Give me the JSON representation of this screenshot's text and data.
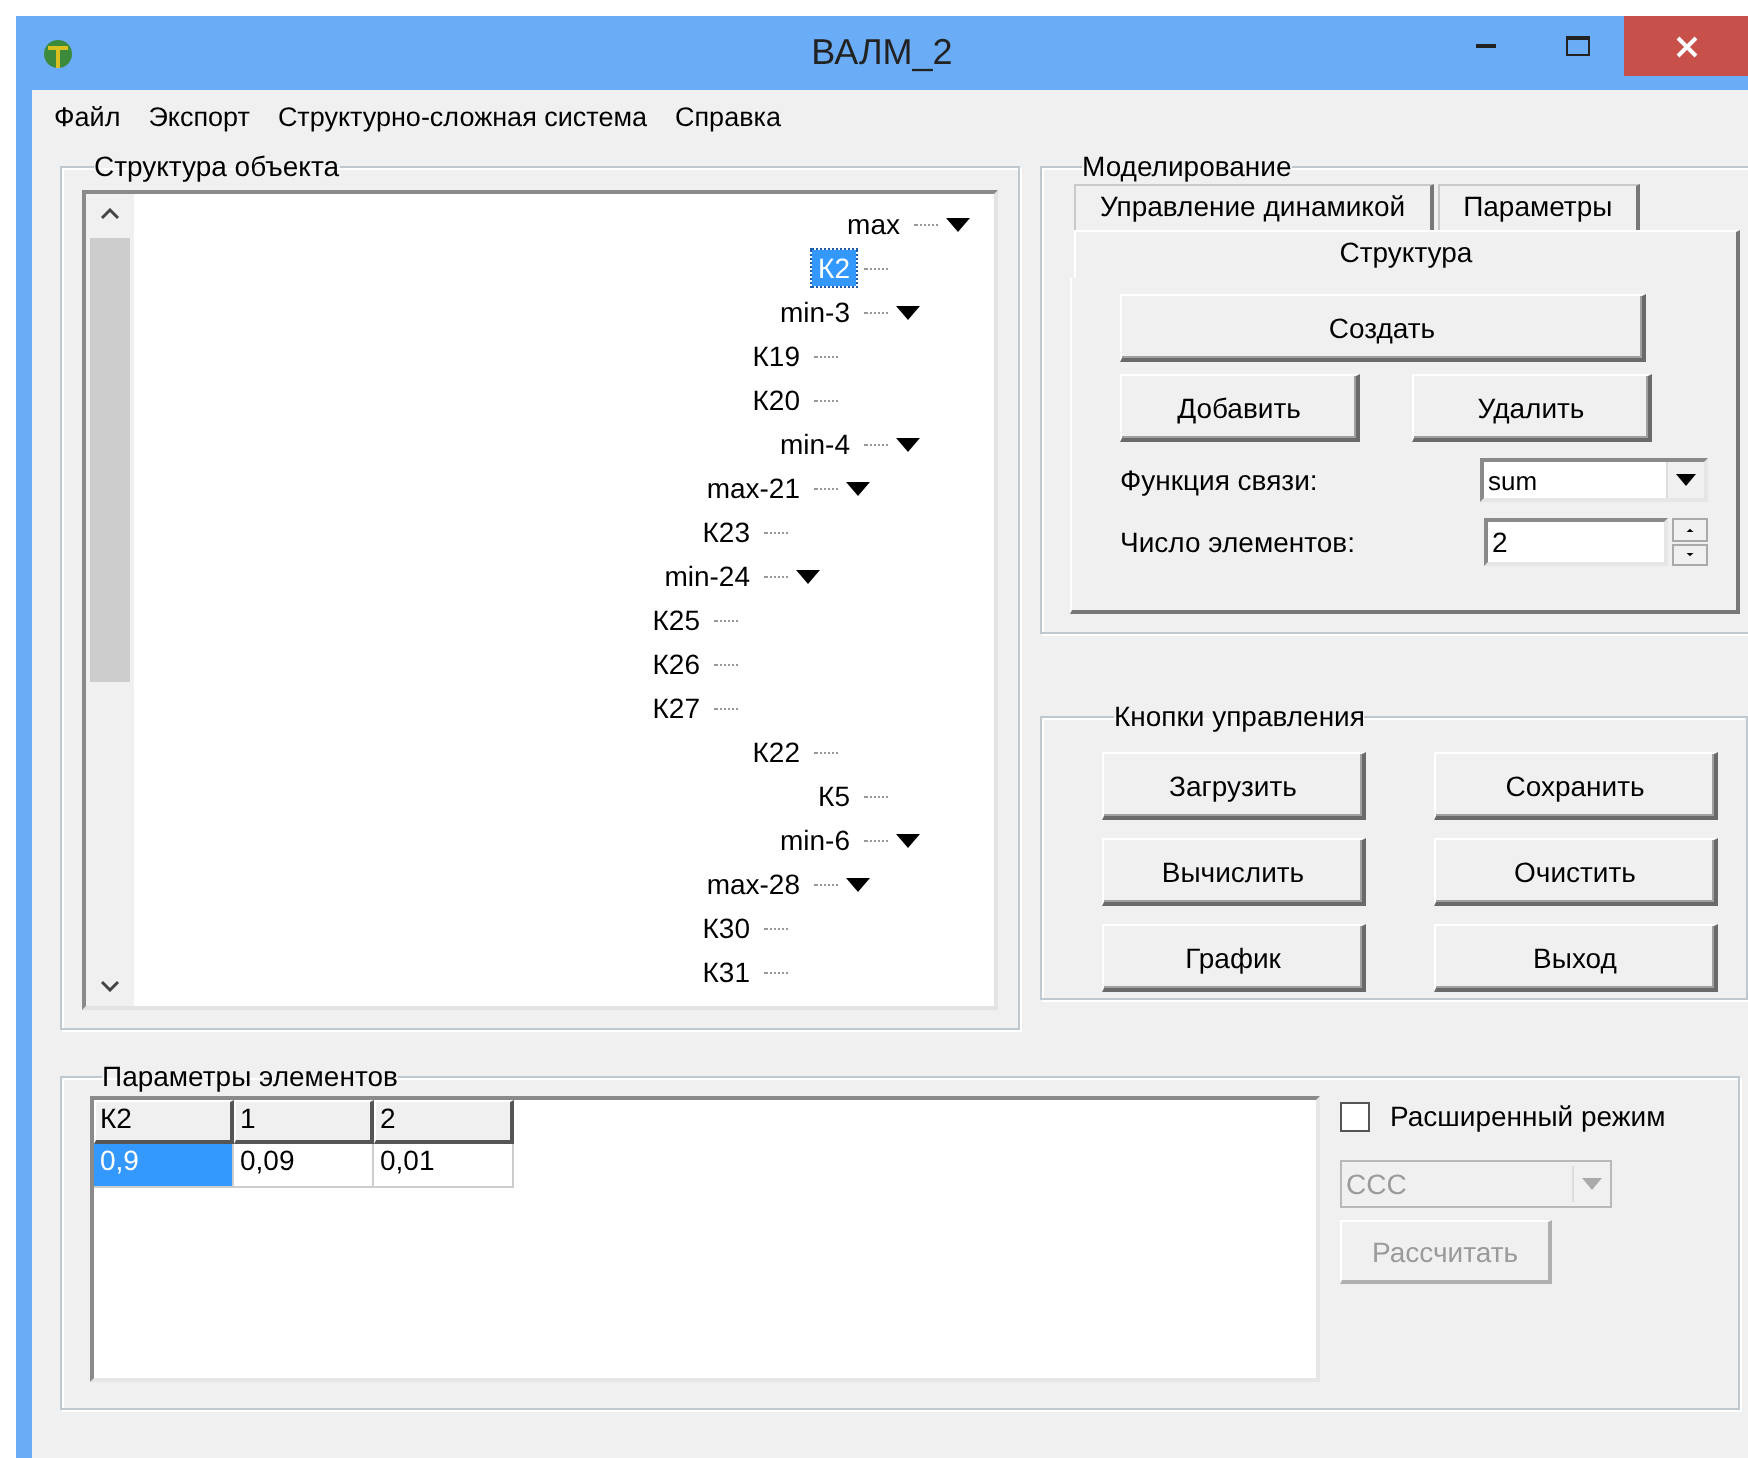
{
  "window": {
    "title": "ВАЛМ_2"
  },
  "menu": [
    "Файл",
    "Экспорт",
    "Структурно-сложная система",
    "Справка"
  ],
  "structure_panel": {
    "title": "Структура объекта",
    "tree": [
      {
        "label": "max",
        "selected": false,
        "expanded": true,
        "children": [
          {
            "label": "К2",
            "selected": true
          },
          {
            "label": "min-3",
            "selected": false,
            "expanded": true,
            "children": [
              {
                "label": "К19",
                "selected": false
              },
              {
                "label": "К20",
                "selected": false
              }
            ]
          },
          {
            "label": "min-4",
            "selected": false,
            "expanded": true,
            "children": [
              {
                "label": "max-21",
                "selected": false,
                "expanded": true,
                "children": [
                  {
                    "label": "К23",
                    "selected": false
                  },
                  {
                    "label": "min-24",
                    "selected": false,
                    "expanded": true,
                    "children": [
                      {
                        "label": "К25",
                        "selected": false
                      },
                      {
                        "label": "К26",
                        "selected": false
                      },
                      {
                        "label": "К27",
                        "selected": false
                      }
                    ]
                  }
                ]
              },
              {
                "label": "К22",
                "selected": false
              }
            ]
          },
          {
            "label": "К5",
            "selected": false
          },
          {
            "label": "min-6",
            "selected": false,
            "expanded": true,
            "children": [
              {
                "label": "max-28",
                "selected": false,
                "expanded": true,
                "children": [
                  {
                    "label": "К30",
                    "selected": false
                  },
                  {
                    "label": "К31",
                    "selected": false
                  }
                ]
              }
            ]
          }
        ]
      }
    ]
  },
  "modeling": {
    "title": "Моделирование",
    "tabs": [
      {
        "label": "Управление динамикой",
        "selected": false
      },
      {
        "label": "Параметры",
        "selected": false
      },
      {
        "label": "Структура",
        "selected": true
      }
    ],
    "create_button": "Создать",
    "add_button": "Добавить",
    "delete_button": "Удалить",
    "fields": [
      {
        "kind": "combo",
        "label": "Функция связи:",
        "value": "sum"
      },
      {
        "kind": "spin",
        "label": "Число элементов:",
        "value": "2"
      }
    ]
  },
  "control_buttons": {
    "title": "Кнопки управления",
    "buttons": [
      "Загрузить",
      "Сохранить",
      "Вычислить",
      "Очистить",
      "График",
      "Выход"
    ]
  },
  "element_params": {
    "title": "Параметры элементов",
    "table": {
      "columns": [
        "К2",
        "1",
        "2"
      ],
      "rows": [
        [
          {
            "text": "0,9",
            "selected": true
          },
          {
            "text": "0,09",
            "selected": false
          },
          {
            "text": "0,01",
            "selected": false
          }
        ]
      ]
    },
    "extended_mode": {
      "label": "Расширенный режим",
      "checked": false
    },
    "method_select": {
      "value": "ССС",
      "disabled": true
    },
    "calculate_button": {
      "label": "Рассчитать",
      "disabled": true
    }
  }
}
